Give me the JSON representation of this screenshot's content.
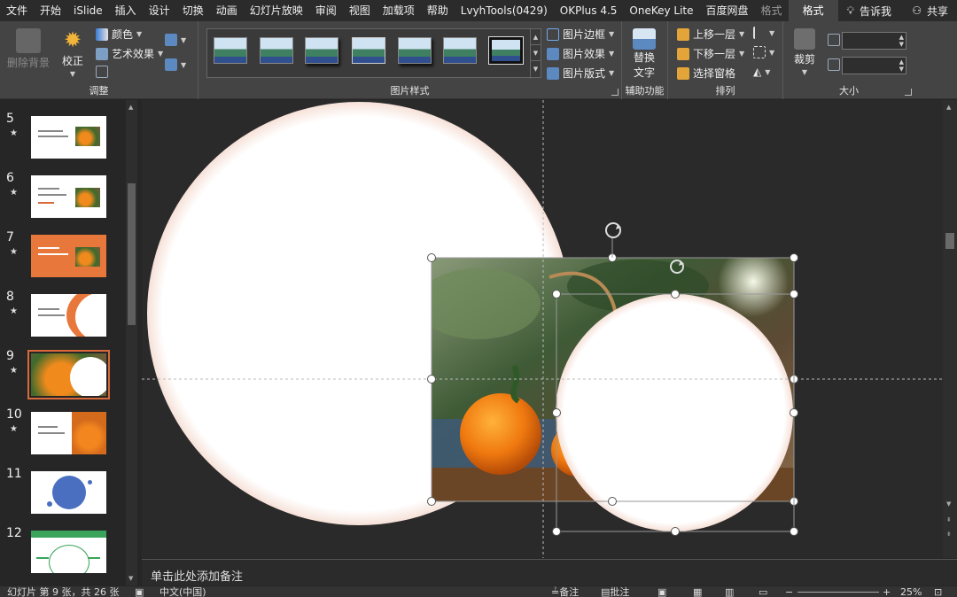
{
  "tabs": [
    "文件",
    "开始",
    "iSlide",
    "插入",
    "设计",
    "切换",
    "动画",
    "幻灯片放映",
    "审阅",
    "视图",
    "加载项",
    "帮助",
    "LvyhTools(0429)",
    "OKPlus 4.5",
    "OneKey Lite",
    "百度网盘",
    "格式",
    "格式"
  ],
  "tell_me": "告诉我",
  "share": "共享",
  "ribbon": {
    "adjust": {
      "remove_bg": "删除背景",
      "correct": "校正",
      "color": "颜色",
      "art_effects": "艺术效果",
      "label": "调整"
    },
    "styles": {
      "border": "图片边框",
      "effects": "图片效果",
      "layout": "图片版式",
      "label": "图片样式"
    },
    "accessibility": {
      "alt_text_1": "替换",
      "alt_text_2": "文字",
      "label": "辅助功能"
    },
    "arrange": {
      "forward": "上移一层",
      "backward": "下移一层",
      "selection_pane": "选择窗格",
      "label": "排列"
    },
    "size": {
      "crop": "裁剪",
      "label": "大小"
    }
  },
  "slides": [
    {
      "num": "5",
      "star": "★",
      "kind": "title-image"
    },
    {
      "num": "6",
      "star": "★",
      "kind": "title-image"
    },
    {
      "num": "7",
      "star": "★",
      "kind": "orange"
    },
    {
      "num": "8",
      "star": "★",
      "kind": "arc"
    },
    {
      "num": "9",
      "star": "★",
      "kind": "selected"
    },
    {
      "num": "10",
      "star": "★",
      "kind": "oranges-right"
    },
    {
      "num": "11",
      "star": "",
      "kind": "circles"
    },
    {
      "num": "12",
      "star": "",
      "kind": "diagram"
    }
  ],
  "notes_placeholder": "单击此处添加备注",
  "status": {
    "slide_info": "幻灯片 第 9 张，共 26 张",
    "language": "中文(中国)",
    "notes": "备注",
    "comments": "批注",
    "zoom": "25%"
  },
  "colors": {
    "accent": "#d9693a",
    "ribbon_bg": "#444444",
    "canvas_bg": "#2a2a2a"
  }
}
